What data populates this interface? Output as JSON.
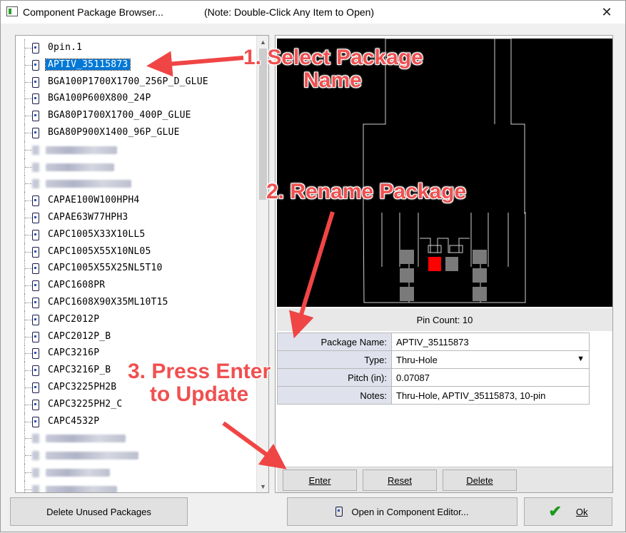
{
  "window": {
    "title": "Component Package Browser...",
    "note": "(Note: Double-Click Any Item to Open)",
    "close_glyph": "✕"
  },
  "tree": {
    "items": [
      {
        "label": "0pin.1",
        "selected": false,
        "blurred": false
      },
      {
        "label": "APTIV_35115873",
        "selected": true,
        "blurred": false
      },
      {
        "label": "BGA100P1700X1700_256P_D_GLUE",
        "selected": false,
        "blurred": false
      },
      {
        "label": "BGA100P600X800_24P",
        "selected": false,
        "blurred": false
      },
      {
        "label": "BGA80P1700X1700_400P_GLUE",
        "selected": false,
        "blurred": false
      },
      {
        "label": "BGA80P900X1400_96P_GLUE",
        "selected": false,
        "blurred": false
      },
      {
        "label": "",
        "selected": false,
        "blurred": true
      },
      {
        "label": "",
        "selected": false,
        "blurred": true
      },
      {
        "label": "",
        "selected": false,
        "blurred": true
      },
      {
        "label": "CAPAE100W100HPH4",
        "selected": false,
        "blurred": false
      },
      {
        "label": "CAPAE63W77HPH3",
        "selected": false,
        "blurred": false
      },
      {
        "label": "CAPC1005X33X10LL5",
        "selected": false,
        "blurred": false
      },
      {
        "label": "CAPC1005X55X10NL05",
        "selected": false,
        "blurred": false
      },
      {
        "label": "CAPC1005X55X25NL5T10",
        "selected": false,
        "blurred": false
      },
      {
        "label": "CAPC1608PR",
        "selected": false,
        "blurred": false
      },
      {
        "label": "CAPC1608X90X35ML10T15",
        "selected": false,
        "blurred": false
      },
      {
        "label": "CAPC2012P",
        "selected": false,
        "blurred": false
      },
      {
        "label": "CAPC2012P_B",
        "selected": false,
        "blurred": false
      },
      {
        "label": "CAPC3216P",
        "selected": false,
        "blurred": false
      },
      {
        "label": "CAPC3216P_B",
        "selected": false,
        "blurred": false
      },
      {
        "label": "CAPC3225PH2B",
        "selected": false,
        "blurred": false
      },
      {
        "label": "CAPC3225PH2_C",
        "selected": false,
        "blurred": false
      },
      {
        "label": "CAPC4532P",
        "selected": false,
        "blurred": false
      },
      {
        "label": "",
        "selected": false,
        "blurred": true
      },
      {
        "label": "",
        "selected": false,
        "blurred": true
      },
      {
        "label": "",
        "selected": false,
        "blurred": true
      },
      {
        "label": "",
        "selected": false,
        "blurred": true
      }
    ],
    "scroll_up": "▲",
    "scroll_down": "▼"
  },
  "preview": {
    "pin_count": "Pin Count: 10"
  },
  "properties": {
    "package_name_label": "Package Name:",
    "package_name_value": "APTIV_35115873",
    "type_label": "Type:",
    "type_value": "Thru-Hole",
    "pitch_label": "Pitch (in):",
    "pitch_value": "0.07087",
    "notes_label": "Notes:",
    "notes_value": "Thru-Hole, APTIV_35115873, 10-pin",
    "dropdown_glyph": "▼"
  },
  "actions": {
    "enter": "Enter",
    "reset": "Reset",
    "delete": "Delete"
  },
  "footer": {
    "delete_unused": "Delete Unused Packages",
    "open_editor": "Open in Component Editor...",
    "ok": "Ok"
  },
  "annotations": {
    "step1_line1": "1. Select Package",
    "step1_line2": "Name",
    "step2": "2. Rename Package",
    "step3_line1": "3. Press Enter",
    "step3_line2": "to Update"
  },
  "colors": {
    "selection": "#0078d7",
    "annotation": "#f05050",
    "pad_red": "#ff0000",
    "pad_gray": "#7a7a7a",
    "ok_check": "#1a9a1a"
  }
}
